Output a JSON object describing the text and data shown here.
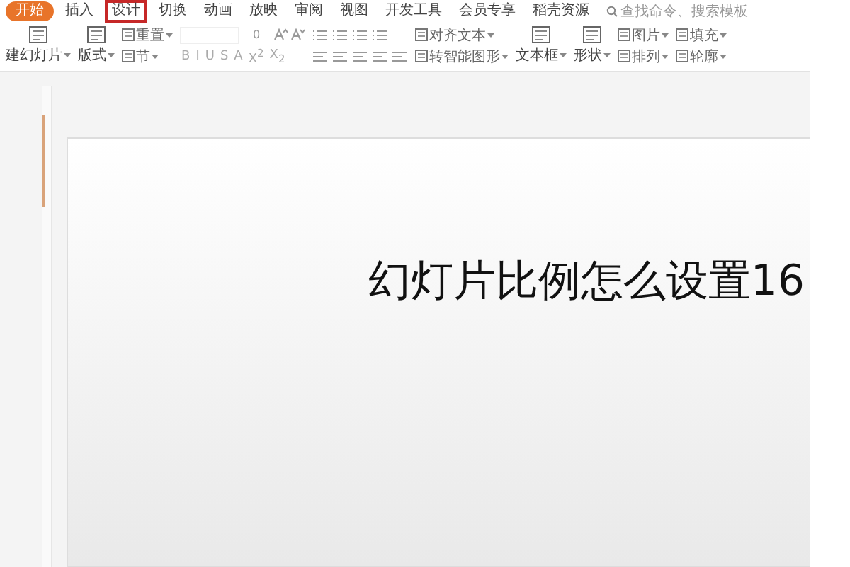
{
  "menu_tabs": [
    {
      "label": "开始",
      "selected": true,
      "highlighted": false
    },
    {
      "label": "插入",
      "selected": false,
      "highlighted": false
    },
    {
      "label": "设计",
      "selected": false,
      "highlighted": true
    },
    {
      "label": "切换",
      "selected": false,
      "highlighted": false
    },
    {
      "label": "动画",
      "selected": false,
      "highlighted": false
    },
    {
      "label": "放映",
      "selected": false,
      "highlighted": false
    },
    {
      "label": "审阅",
      "selected": false,
      "highlighted": false
    },
    {
      "label": "视图",
      "selected": false,
      "highlighted": false
    },
    {
      "label": "开发工具",
      "selected": false,
      "highlighted": false
    },
    {
      "label": "会员专享",
      "selected": false,
      "highlighted": false
    },
    {
      "label": "稻壳资源",
      "selected": false,
      "highlighted": false
    }
  ],
  "search": {
    "placeholder": "查找命令、搜索模板"
  },
  "ribbon": [
    {
      "kind": "large",
      "label": "建幻灯片"
    },
    {
      "kind": "large",
      "label": "版式"
    },
    {
      "kind": "pair",
      "top": "重置",
      "bottom": "节"
    },
    {
      "kind": "font",
      "size": "0",
      "glyphs": [
        "B",
        "I",
        "U",
        "S",
        "A",
        "X$^{2}$",
        "X$_{2}$"
      ]
    },
    {
      "kind": "paragraph"
    },
    {
      "kind": "pair",
      "top": "对齐文本",
      "bottom": "转智能图形"
    },
    {
      "kind": "large",
      "label": "文本框"
    },
    {
      "kind": "large",
      "label": "形状"
    },
    {
      "kind": "pair",
      "top": "图片",
      "bottom": "排列"
    },
    {
      "kind": "pair",
      "top": "填充",
      "bottom": "轮廓"
    }
  ],
  "slide": {
    "title": "幻灯片比例怎么设置16"
  }
}
